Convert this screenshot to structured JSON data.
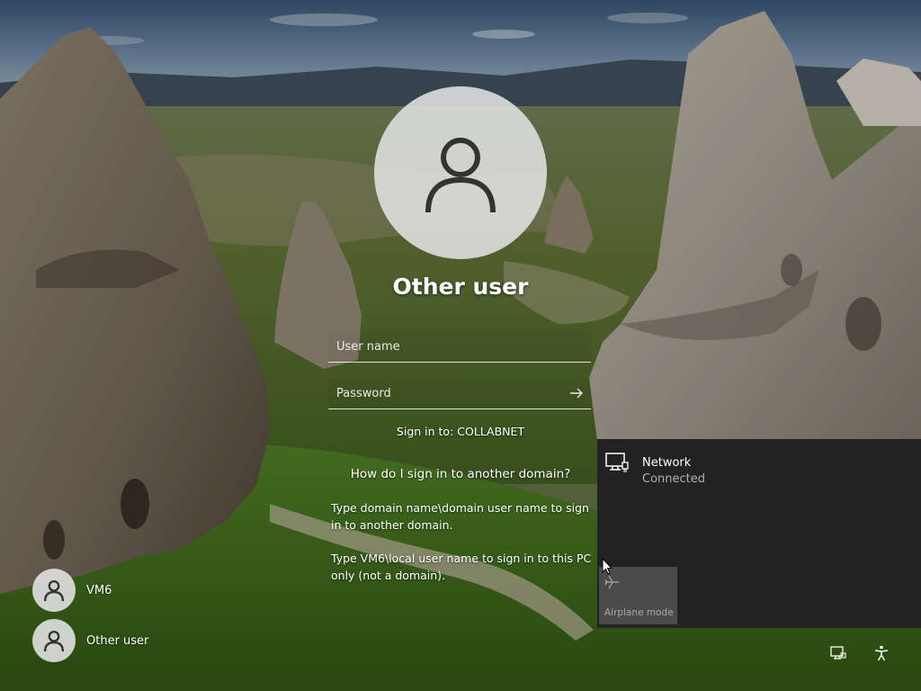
{
  "login": {
    "title": "Other user",
    "username_placeholder": "User name",
    "password_placeholder": "Password",
    "sign_in_to": "Sign in to: COLLABNET",
    "domain_help_link": "How do I sign in to another domain?",
    "help_text_1": "Type domain name\\domain user name to sign in to another domain.",
    "help_text_2": "Type VM6\\local user name to sign in to this PC only (not a domain)."
  },
  "user_list": [
    {
      "name": "VM6"
    },
    {
      "name": "Other user"
    }
  ],
  "network_flyout": {
    "network_name": "Network",
    "network_status": "Connected",
    "airplane_mode_label": "Airplane mode"
  },
  "tray": {
    "icons": [
      "network-icon",
      "accessibility-icon"
    ]
  },
  "colors": {
    "flyout_bg": "#222222",
    "tile_bg": "#4b4b4b",
    "text": "#ffffff",
    "muted_text": "#b0b0b0"
  }
}
